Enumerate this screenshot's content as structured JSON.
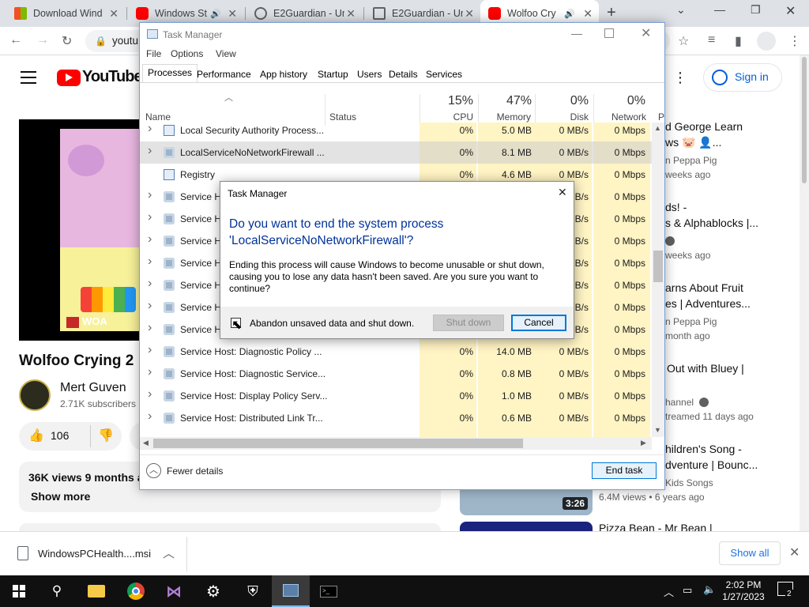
{
  "browser": {
    "tabs": [
      {
        "title": "Download Wind",
        "favicon_color": "#1e88e5",
        "active": false
      },
      {
        "title": "Windows St",
        "favicon_color": "#ff0000",
        "active": false,
        "audio": true
      },
      {
        "title": "E2Guardian - Un",
        "favicon_color": "#5f6368",
        "active": false
      },
      {
        "title": "E2Guardian - Un",
        "favicon_color": "#5f6368",
        "active": false
      },
      {
        "title": "Wolfoo Cry",
        "favicon_color": "#ff0000",
        "active": true,
        "audio": true
      }
    ],
    "url": "youtu",
    "new_tab_symbol": "+"
  },
  "youtube": {
    "logo_text": "YouTube",
    "sign_in": "Sign in",
    "video_title": "Wolfoo Crying 2",
    "channel_name": "Mert Guven",
    "subscribers": "2.71K subscribers",
    "likes": "106",
    "views_line": "36K views  9 months a",
    "show_more": "Show more",
    "woa_badge": "WOA",
    "recommendations": [
      {
        "title_line1": "d George Learn",
        "title_line2": "ws 🐷 👤...",
        "channel": "n Peppa Pig",
        "meta": "weeks ago"
      },
      {
        "title_line1": "ds! -",
        "title_line2": "s & Alphablocks |...",
        "channel": "",
        "meta": "weeks ago"
      },
      {
        "title_line1": "arns About Fruit",
        "title_line2": "es | Adventures...",
        "channel": "n Peppa Pig",
        "meta": "month ago"
      },
      {
        "title_line1": "Out with Bluey |",
        "title_line2": "",
        "channel": "hannel",
        "meta": "treamed 11 days ago"
      },
      {
        "title_line1": "hildren's Song -",
        "title_line2": "dventure | Bounc...",
        "channel": "Kids Songs",
        "meta": "6.4M views  •  6 years ago"
      },
      {
        "title_line1": "Pizza Bean - Mr Bean |",
        "title_line2": "",
        "channel": "",
        "meta": ""
      }
    ],
    "thumb_duration": "3:26"
  },
  "task_manager": {
    "title": "Task Manager",
    "menu": [
      "File",
      "Options",
      "View"
    ],
    "tabs": [
      "Processes",
      "Performance",
      "App history",
      "Startup",
      "Users",
      "Details",
      "Services"
    ],
    "active_tab": "Processes",
    "columns": {
      "name": "Name",
      "status": "Status",
      "cpu_pct": "15%",
      "cpu": "CPU",
      "mem_pct": "47%",
      "mem": "Memory",
      "disk_pct": "0%",
      "disk": "Disk",
      "net_pct": "0%",
      "net": "Network",
      "p": "P"
    },
    "rows": [
      {
        "name": "Local Security Authority Process...",
        "cpu": "0%",
        "mem": "5.0 MB",
        "disk": "0 MB/s",
        "net": "0 Mbps",
        "expand": true
      },
      {
        "name": "LocalServiceNoNetworkFirewall ...",
        "cpu": "0%",
        "mem": "8.1 MB",
        "disk": "0 MB/s",
        "net": "0 Mbps",
        "expand": true,
        "selected": true
      },
      {
        "name": "Registry",
        "cpu": "0%",
        "mem": "4.6 MB",
        "disk": "0 MB/s",
        "net": "0 Mbps",
        "expand": false
      },
      {
        "name": "Service Host: ...",
        "cpu": "",
        "mem": "",
        "disk": "MB/s",
        "net": "0 Mbps",
        "expand": true
      },
      {
        "name": "Service Host: ...",
        "cpu": "",
        "mem": "",
        "disk": "MB/s",
        "net": "0 Mbps",
        "expand": true
      },
      {
        "name": "Service Host: ...",
        "cpu": "",
        "mem": "",
        "disk": "MB/s",
        "net": "0 Mbps",
        "expand": true
      },
      {
        "name": "Service Host: ...",
        "cpu": "",
        "mem": "",
        "disk": "MB/s",
        "net": "0 Mbps",
        "expand": true
      },
      {
        "name": "Service Host: ...",
        "cpu": "",
        "mem": "",
        "disk": "MB/s",
        "net": "0 Mbps",
        "expand": true
      },
      {
        "name": "Service Host: ...",
        "cpu": "",
        "mem": "",
        "disk": "MB/s",
        "net": "0 Mbps",
        "expand": true
      },
      {
        "name": "Service Host: ...",
        "cpu": "",
        "mem": "",
        "disk": "MB/s",
        "net": "0 Mbps",
        "expand": true
      },
      {
        "name": "Service Host: Diagnostic Policy ...",
        "cpu": "0%",
        "mem": "14.0 MB",
        "disk": "0 MB/s",
        "net": "0 Mbps",
        "expand": true
      },
      {
        "name": "Service Host: Diagnostic Service...",
        "cpu": "0%",
        "mem": "0.8 MB",
        "disk": "0 MB/s",
        "net": "0 Mbps",
        "expand": true
      },
      {
        "name": "Service Host: Display Policy Serv...",
        "cpu": "0%",
        "mem": "1.0 MB",
        "disk": "0 MB/s",
        "net": "0 Mbps",
        "expand": true
      },
      {
        "name": "Service Host: Distributed Link Tr...",
        "cpu": "0%",
        "mem": "0.6 MB",
        "disk": "0 MB/s",
        "net": "0 Mbps",
        "expand": true
      }
    ],
    "fewer_details": "Fewer details",
    "end_task": "End task"
  },
  "dialog": {
    "title": "Task Manager",
    "heading_line1": "Do you want to end the system process",
    "heading_line2": "'LocalServiceNoNetworkFirewall'?",
    "body_line1": "Ending this process will cause Windows to become unusable or shut down,",
    "body_line2": "causing you to lose any data hasn't been saved. Are you sure you want to",
    "body_line3": "continue?",
    "checkbox_label": "Abandon unsaved data and shut down.",
    "checkbox_checked": false,
    "shutdown_button": "Shut down",
    "cancel_button": "Cancel"
  },
  "download_bar": {
    "file": "WindowsPCHealth....msi",
    "show_all": "Show all"
  },
  "taskbar": {
    "time": "2:02 PM",
    "date": "1/27/2023",
    "notification_count": "2"
  }
}
